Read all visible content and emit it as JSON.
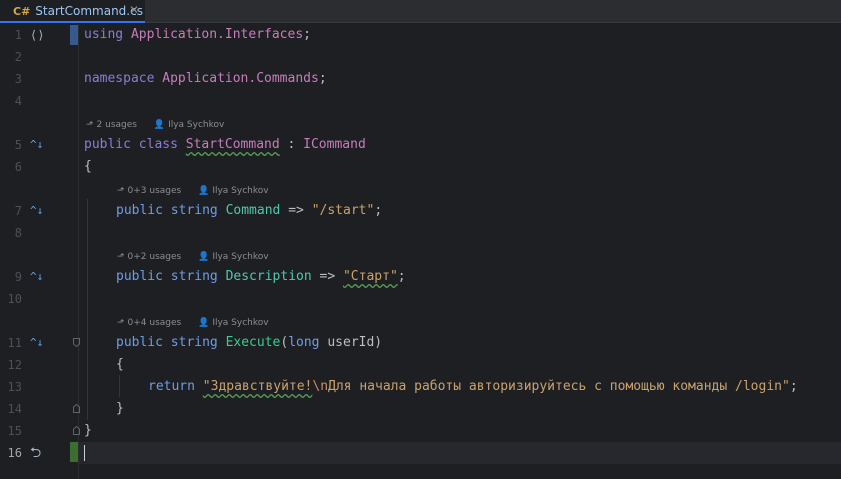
{
  "tab": {
    "lang_badge": "C#",
    "filename": "StartCommand.cs",
    "close_glyph": "✕"
  },
  "hints": {
    "class_usages": "2 usages",
    "command_usages": "0+3 usages",
    "description_usages": "0+2 usages",
    "execute_usages": "0+4 usages",
    "author": "Ilya Sychkov"
  },
  "lines": [
    {
      "n": "1"
    },
    {
      "n": "2"
    },
    {
      "n": "3"
    },
    {
      "n": "4"
    },
    {
      "n": "5"
    },
    {
      "n": "6"
    },
    {
      "n": "7"
    },
    {
      "n": "8"
    },
    {
      "n": "9"
    },
    {
      "n": "10"
    },
    {
      "n": "11"
    },
    {
      "n": "12"
    },
    {
      "n": "13"
    },
    {
      "n": "14"
    },
    {
      "n": "15"
    },
    {
      "n": "16"
    }
  ],
  "code": {
    "l1_kw": "using",
    "l1_ns": "Application.Interfaces",
    "l1_end": ";",
    "l3_kw": "namespace",
    "l3_ns": "Application.Commands",
    "l3_end": ";",
    "l5_kw": "public class",
    "l5_name": "StartCommand",
    "l5_colon": " : ",
    "l5_iface": "ICommand",
    "l6": "{",
    "l7_kw": "public string",
    "l7_name": "Command",
    "l7_arrow": " => ",
    "l7_str": "\"/start\"",
    "l7_end": ";",
    "l9_kw": "public string",
    "l9_name": "Description",
    "l9_arrow": " => ",
    "l9_str": "\"Старт\"",
    "l9_end": ";",
    "l11_kw": "public string",
    "l11_name": "Execute",
    "l11_paren": "(",
    "l11_type": "long",
    "l11_param": " userId)",
    "l12": "{",
    "l13_kw": "return",
    "l13_str1": "\"Здравствуйте!",
    "l13_esc": "\\n",
    "l13_str2": "Для начала работы авторизируйтесь с помощью команды /login\"",
    "l13_end": ";",
    "l14": "}",
    "l15": "}"
  },
  "icons": {
    "structure": "⟨⟩",
    "override": "^↓",
    "return": "⮌"
  },
  "colors": {
    "background": "#1e1f22",
    "keyword": "#8e7bd6",
    "string": "#c9a26d",
    "method": "#39cc8f",
    "property": "#4ec9b0"
  }
}
